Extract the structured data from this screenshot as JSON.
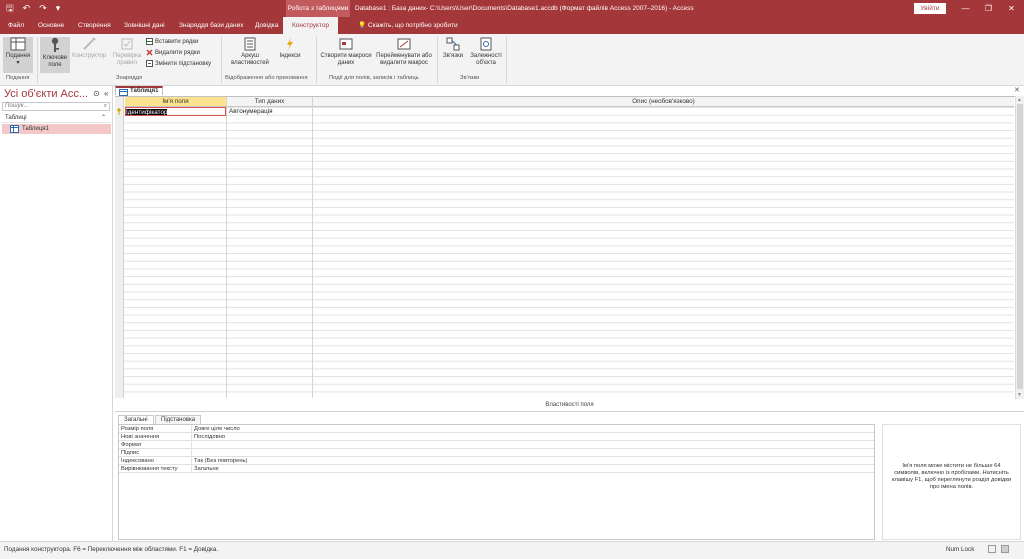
{
  "title_bar": {
    "quick_access": [
      {
        "icon": "save-icon",
        "glyph": "🖫"
      },
      {
        "icon": "undo-icon",
        "glyph": "↶"
      },
      {
        "icon": "redo-icon",
        "glyph": "↷"
      },
      {
        "icon": "customize-qat-icon",
        "glyph": "▾"
      }
    ],
    "context_tool": "Робота з таблицями",
    "window_title": "Database1 : База даних- C:\\Users\\User\\Documents\\Database1.accdb (Формат файлів Access 2007–2016)  -  Access",
    "sign_in": "Увійти",
    "minimize": "—",
    "restore": "❐",
    "close": "✕"
  },
  "ribbon_tabs": [
    {
      "label": "Файл"
    },
    {
      "label": "Основне"
    },
    {
      "label": "Створення"
    },
    {
      "label": "Зовнішні дані"
    },
    {
      "label": "Знаряддя бази даних"
    },
    {
      "label": "Довідка"
    },
    {
      "label": "Конструктор"
    }
  ],
  "tell_me": "Скажіть, що потрібно зробити",
  "ribbon": {
    "view_label": "Подання",
    "primary_key": "Ключове поле",
    "builder": "Конструктор",
    "test_rules": "Перевірка правил",
    "insert_rows": "Вставити рядки",
    "delete_rows": "Видалити рядки",
    "modify_lookups": "Змінити підстановку",
    "property_sheet": "Аркуш властивостей",
    "indexes": "Індекси",
    "create_macros": "Створити макроси даних",
    "rename_macro": "Перейменувати або видалити макрос",
    "relationships": "Зв'язки",
    "dependencies": "Залежності об'єкта",
    "groups": {
      "views": "Подання",
      "tools": "Знаряддя",
      "show_hide": "Відображення або приховання",
      "events": "Події для полів, записів і таблиць",
      "relationships": "Зв'язки"
    }
  },
  "nav_pane": {
    "title": "Усі об'єкти Acc...",
    "search_placeholder": "Пошук...",
    "section": "Таблиці",
    "items": [
      {
        "label": "Таблиця1"
      }
    ]
  },
  "document": {
    "tab": "Таблиця1",
    "columns": [
      "Ім'я поля",
      "Тип даних",
      "Опис (необов'язково)"
    ],
    "rows": [
      {
        "field_name": "Ідентифікатор",
        "data_type": "Автонумерація",
        "description": ""
      }
    ]
  },
  "field_properties": {
    "title": "Властивості поля",
    "tabs": [
      "Загальні",
      "Підстановка"
    ],
    "rows": [
      {
        "key": "Розмір поля",
        "value": "Довге ціле число"
      },
      {
        "key": "Нові значення",
        "value": "Послідовно"
      },
      {
        "key": "Формат",
        "value": ""
      },
      {
        "key": "Підпис",
        "value": ""
      },
      {
        "key": "Індексовано",
        "value": "Так (Без повторень)"
      },
      {
        "key": "Вирівнювання тексту",
        "value": "Загальне"
      }
    ],
    "help": "Ім'я поля може містити не більше 64 символів, включно із пробілами. Натисніть клавішу F1, щоб переглянути розділ довідки про імена полів."
  },
  "status_bar": {
    "text": "Подання конструктора.  F6 = Переключення між областями.  F1 = Довідка.",
    "num_lock": "Num Lock"
  },
  "colors": {
    "accent": "#a4373a",
    "selected_header": "#fbe28e",
    "nav_selected": "#f4c7c8"
  }
}
